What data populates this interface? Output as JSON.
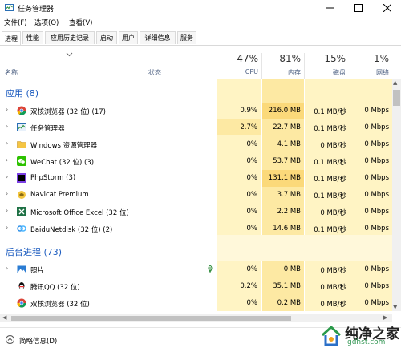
{
  "window": {
    "title": "任务管理器"
  },
  "menu": [
    "文件(F)",
    "选项(O)",
    "查看(V)"
  ],
  "tabs": [
    "进程",
    "性能",
    "应用历史记录",
    "启动",
    "用户",
    "详细信息",
    "服务"
  ],
  "header": {
    "name_label": "名称",
    "status_label": "状态",
    "cpu": {
      "pct": "47%",
      "label": "CPU"
    },
    "mem": {
      "pct": "81%",
      "label": "内存"
    },
    "disk": {
      "pct": "15%",
      "label": "磁盘"
    },
    "net": {
      "pct": "1%",
      "label": "网络"
    }
  },
  "apps_group": "应用 (8)",
  "apps": [
    {
      "name": "双核浏览器 (32 位) (17)",
      "cpu": "0.9%",
      "mem": "216.0 MB",
      "disk": "0.1 MB/秒",
      "net": "0 Mbps",
      "icon": "chrome-icon"
    },
    {
      "name": "任务管理器",
      "cpu": "2.7%",
      "mem": "22.7 MB",
      "disk": "0.1 MB/秒",
      "net": "0 Mbps",
      "icon": "taskmgr-icon"
    },
    {
      "name": "Windows 资源管理器",
      "cpu": "0%",
      "mem": "4.1 MB",
      "disk": "0 MB/秒",
      "net": "0 Mbps",
      "icon": "folder-icon"
    },
    {
      "name": "WeChat (32 位) (3)",
      "cpu": "0%",
      "mem": "53.7 MB",
      "disk": "0.1 MB/秒",
      "net": "0 Mbps",
      "icon": "wechat-icon"
    },
    {
      "name": "PhpStorm (3)",
      "cpu": "0%",
      "mem": "131.1 MB",
      "disk": "0.1 MB/秒",
      "net": "0 Mbps",
      "icon": "phpstorm-icon"
    },
    {
      "name": "Navicat Premium",
      "cpu": "0%",
      "mem": "3.7 MB",
      "disk": "0.1 MB/秒",
      "net": "0 Mbps",
      "icon": "navicat-icon"
    },
    {
      "name": "Microsoft Office Excel (32 位)",
      "cpu": "0%",
      "mem": "2.2 MB",
      "disk": "0 MB/秒",
      "net": "0 Mbps",
      "icon": "excel-icon"
    },
    {
      "name": "BaiduNetdisk (32 位) (2)",
      "cpu": "0%",
      "mem": "14.6 MB",
      "disk": "0.1 MB/秒",
      "net": "0 Mbps",
      "icon": "baidunetdisk-icon"
    }
  ],
  "bg_group": "后台进程 (73)",
  "bg": [
    {
      "name": "照片",
      "cpu": "0%",
      "mem": "0 MB",
      "disk": "0 MB/秒",
      "net": "0 Mbps",
      "icon": "photos-icon"
    },
    {
      "name": "腾讯QQ (32 位)",
      "cpu": "0.2%",
      "mem": "35.1 MB",
      "disk": "0 MB/秒",
      "net": "0 Mbps",
      "icon": "qq-icon"
    },
    {
      "name": "双核浏览器 (32 位)",
      "cpu": "0%",
      "mem": "0.2 MB",
      "disk": "0 MB/秒",
      "net": "0 Mbps",
      "icon": "chrome-icon"
    }
  ],
  "footer": {
    "label": "简略信息(D)"
  },
  "watermark": {
    "text": "纯净之家",
    "url": "gdhst.com"
  },
  "colors": {
    "yellow_light": "#fff4c4",
    "yellow_mid": "#ffeaa0",
    "yellow_dark": "#fce28a",
    "group_blue": "#1b5bbf"
  }
}
